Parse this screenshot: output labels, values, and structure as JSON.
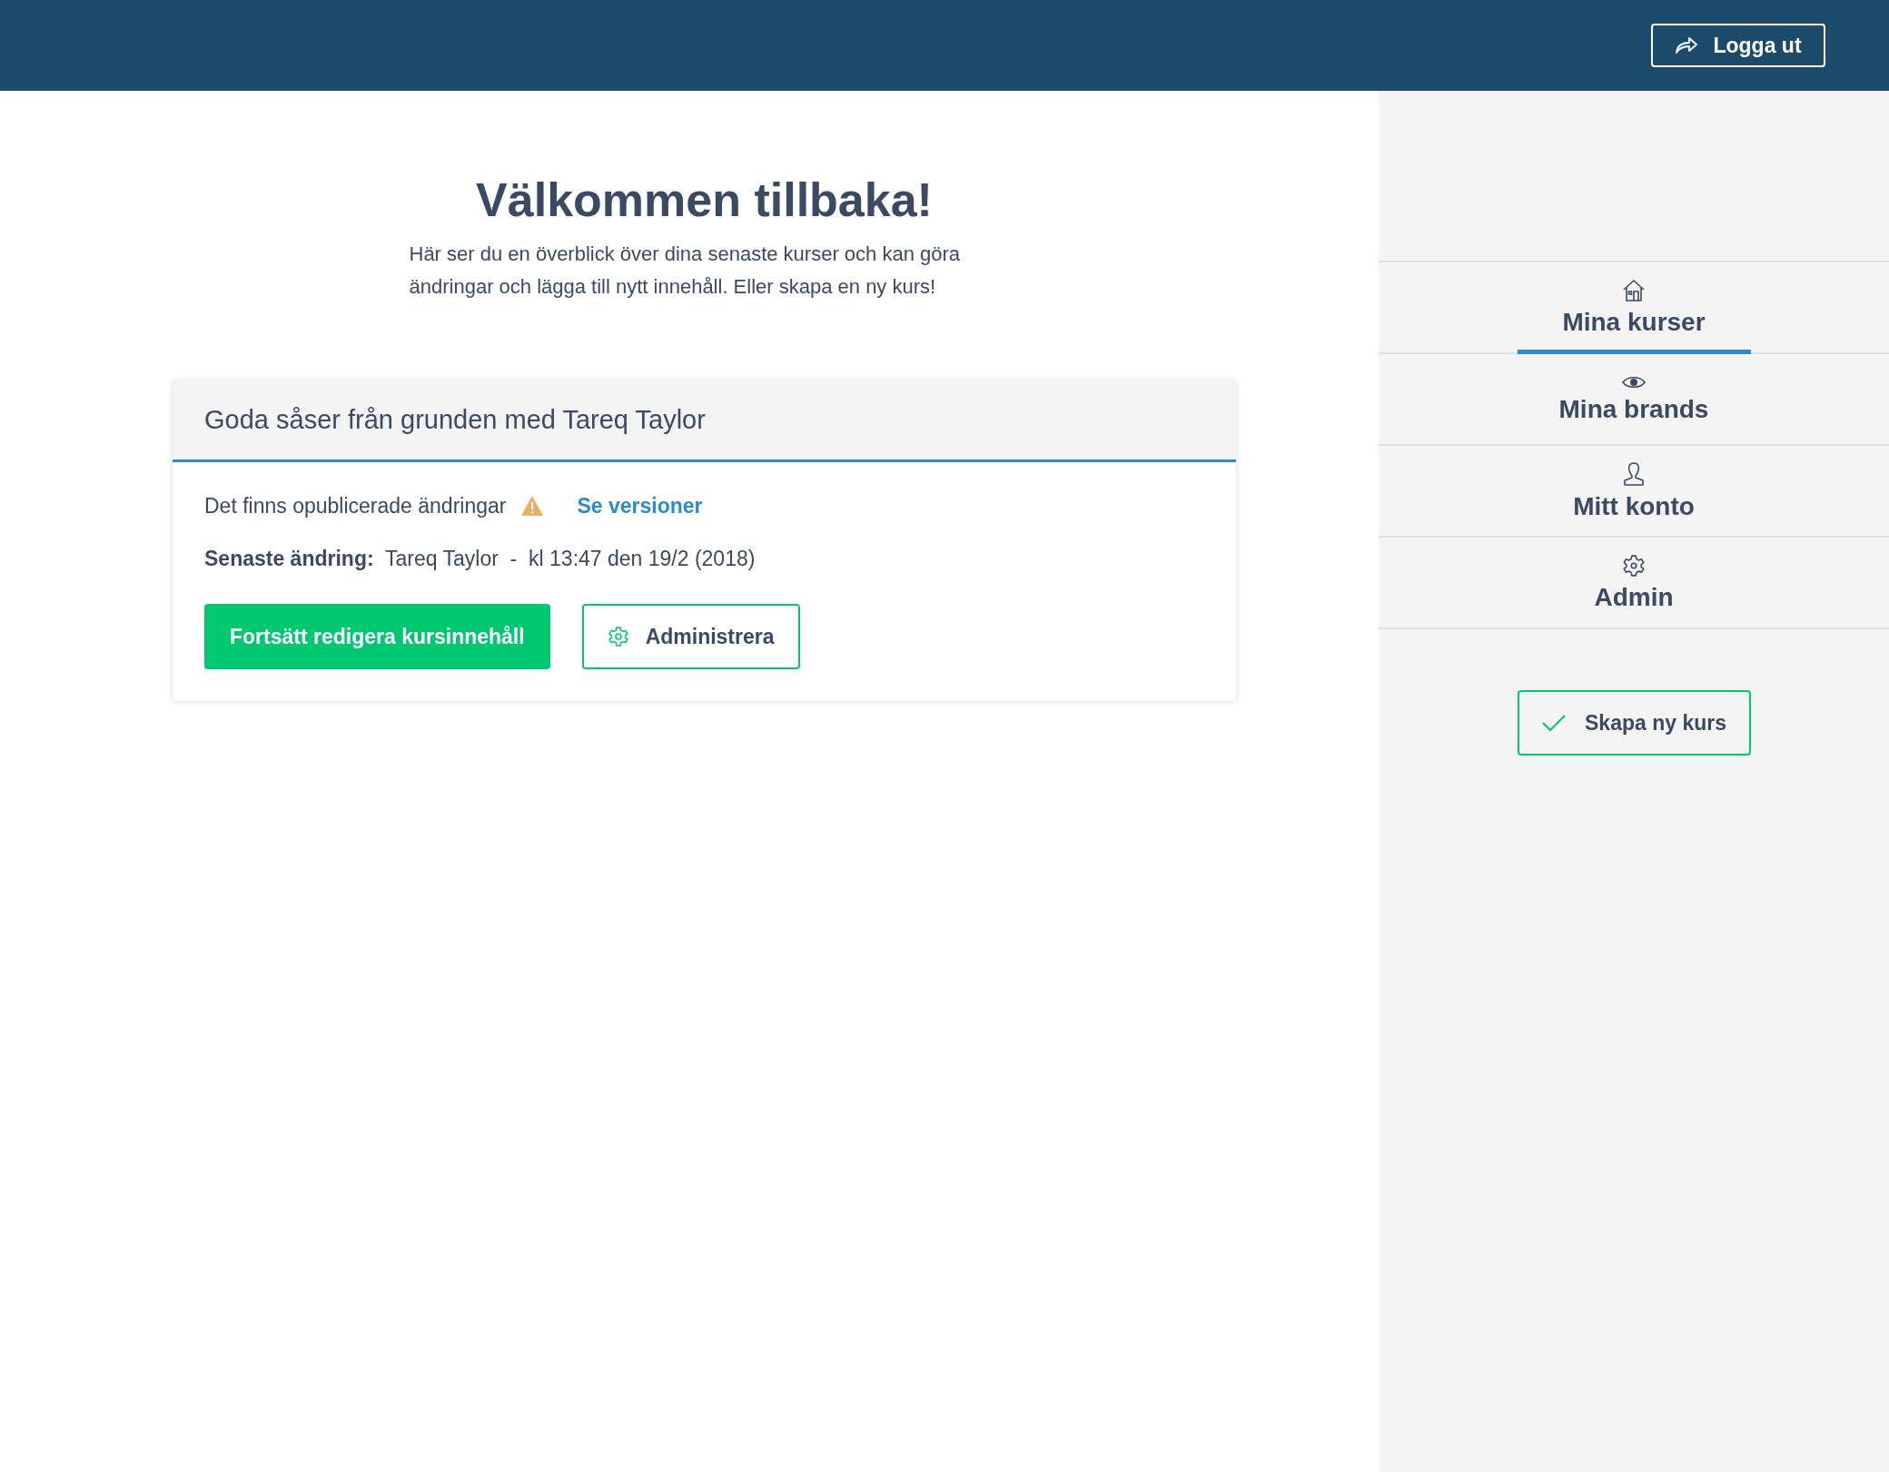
{
  "header": {
    "logout_button": "Logga ut"
  },
  "welcome": {
    "title": "Välkommen tillbaka!",
    "text": "Här ser du en överblick över dina senaste kurser och kan göra ändringar och lägga till nytt innehåll. Eller skapa en ny kurs!"
  },
  "course_card": {
    "title": "Goda såser från grunden med Tareq Taylor",
    "status": "Det finns opublicerade ändringar",
    "warning": true,
    "versions_link": "Se versioner",
    "last_change": "**Senaste ändring:**  Tareq Taylor  -  kl 13:47 den 19/2 (2018)",
    "primary_button": "Fortsätt redigera kursinnehåll",
    "admin_button": "Administrera"
  },
  "sidebar": {
    "items": [
      {
        "label": "Mina kurser",
        "selected": true
      },
      {
        "label": "Mina brands",
        "selected": false
      },
      {
        "label": "Mitt konto",
        "selected": false
      },
      {
        "label": "Admin",
        "selected": false
      }
    ],
    "create_button": "Skapa ny kurs"
  }
}
